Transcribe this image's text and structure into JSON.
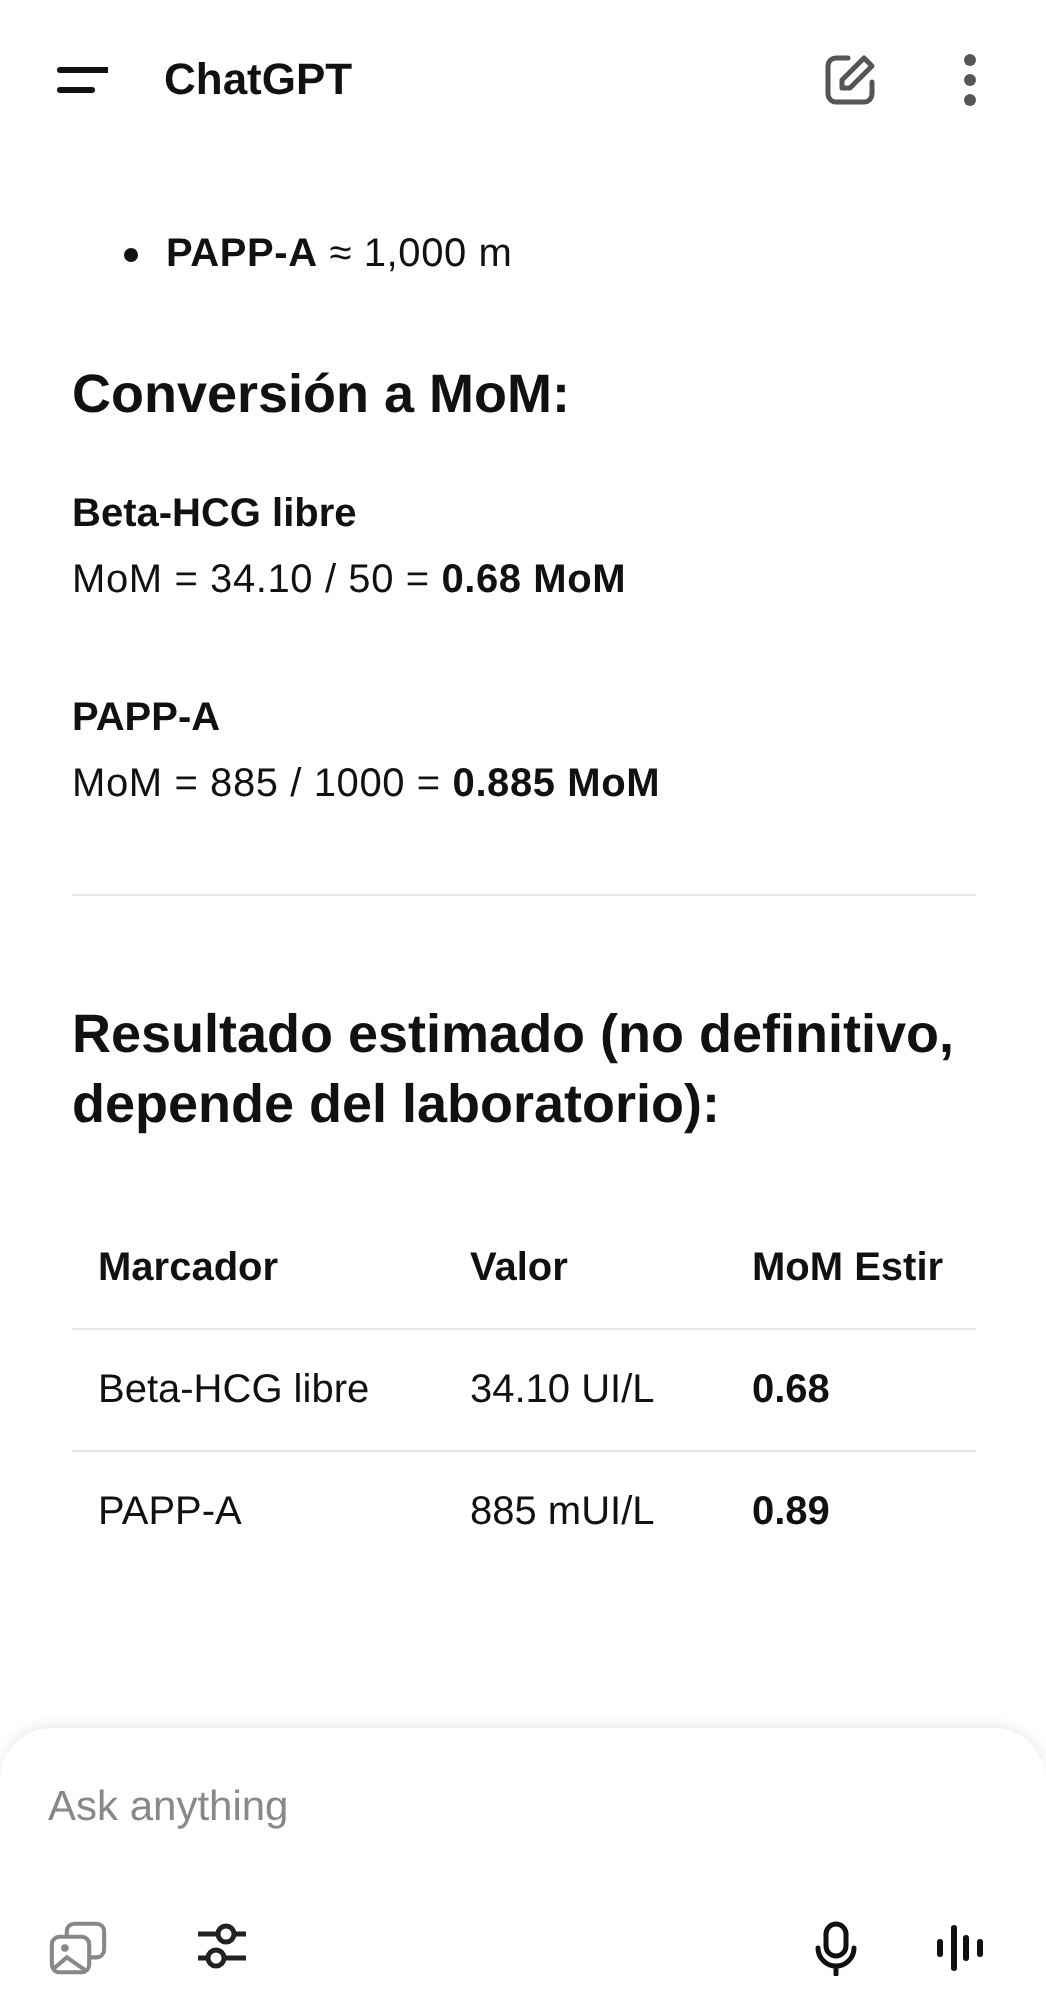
{
  "header": {
    "title": "ChatGPT"
  },
  "bullet": {
    "label": "PAPP-A",
    "text": "≈ 1,000 m"
  },
  "conversion": {
    "heading": "Conversión a MoM:",
    "items": [
      {
        "label": "Beta-HCG libre",
        "formula": "MoM = 34.10 / 50 = **0.68 MoM**"
      },
      {
        "label": "PAPP-A",
        "formula": "MoM = 885 / 1000 = **0.885 MoM**"
      }
    ]
  },
  "result": {
    "heading": "Resultado estimado (no definitivo, depende del laboratorio):"
  },
  "table": {
    "columns": [
      "Marcador",
      "Valor",
      "MoM Estir"
    ],
    "rows": [
      [
        "Beta-HCG libre",
        "34.10 UI/L",
        "0.68"
      ],
      [
        "PAPP-A",
        "885 mUI/L",
        "0.89"
      ]
    ]
  },
  "composer": {
    "placeholder": "Ask anything"
  }
}
